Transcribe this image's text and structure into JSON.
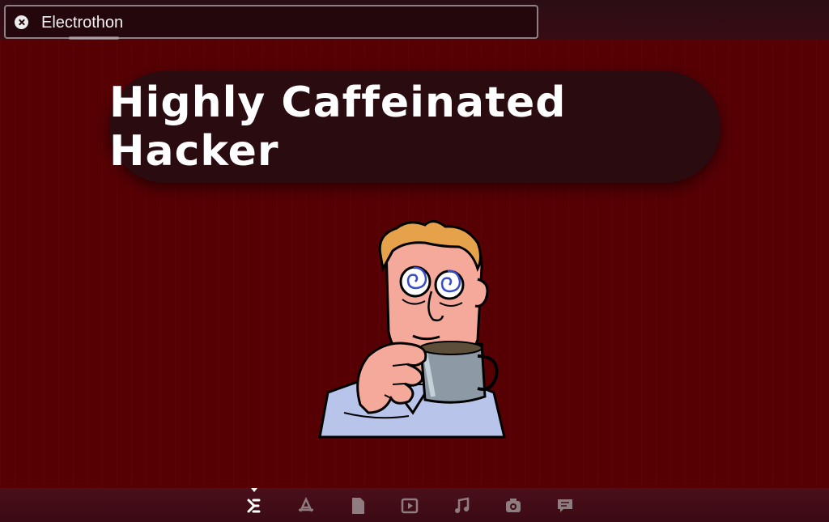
{
  "window": {
    "title": "Electrothon"
  },
  "main": {
    "heading": "Highly Caffeinated Hacker",
    "illustration": "caffeinated-hacker-illustration"
  },
  "dock": {
    "items": [
      {
        "icon": "launcher-icon",
        "active": true
      },
      {
        "icon": "app-store-icon"
      },
      {
        "icon": "document-icon"
      },
      {
        "icon": "video-icon"
      },
      {
        "icon": "music-icon"
      },
      {
        "icon": "camera-icon"
      },
      {
        "icon": "chat-icon"
      }
    ]
  },
  "colors": {
    "background": "#570004",
    "pill": "#2a0b10",
    "text": "#ffffff"
  }
}
